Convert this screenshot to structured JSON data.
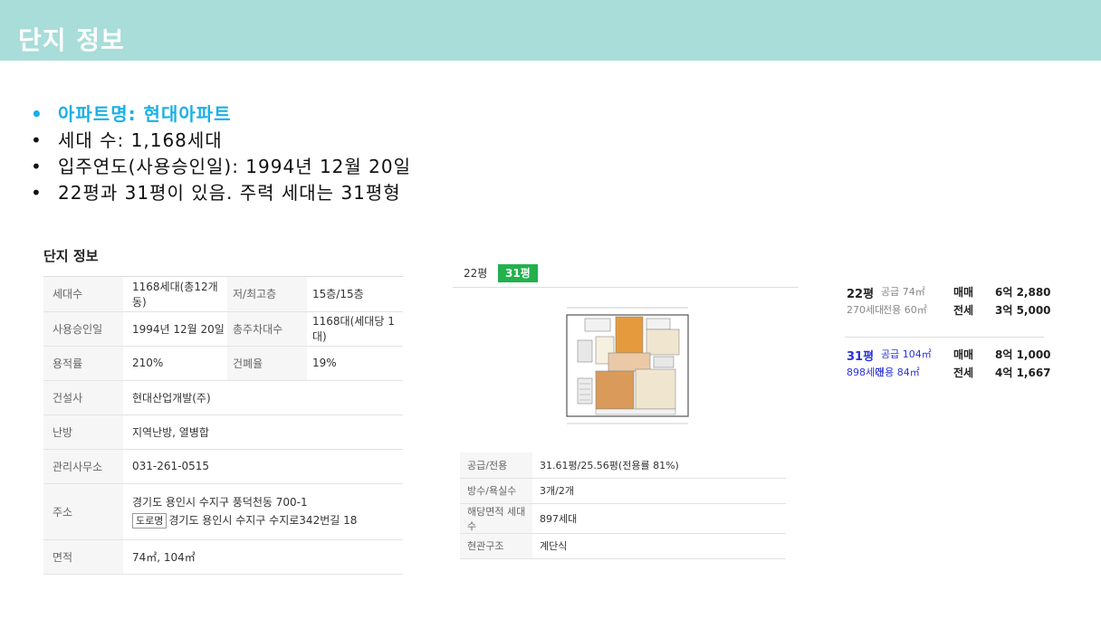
{
  "header": {
    "title": "단지 정보"
  },
  "bullets": [
    "아파트명: 현대아파트",
    "세대 수: 1,168세대",
    "입주연도(사용승인일): 1994년 12월 20일",
    "22평과 31평이 있음. 주력 세대는 31평형"
  ],
  "info": {
    "title": "단지 정보",
    "rows": {
      "units_label": "세대수",
      "units_value": "1168세대(총12개동)",
      "floors_label": "저/최고층",
      "floors_value": "15층/15층",
      "approval_label": "사용승인일",
      "approval_value": "1994년 12월 20일",
      "parking_label": "총주차대수",
      "parking_value": "1168대(세대당 1대)",
      "far_label": "용적률",
      "far_value": "210%",
      "bcr_label": "건폐율",
      "bcr_value": "19%",
      "builder_label": "건설사",
      "builder_value": "현대산업개발(주)",
      "heating_label": "난방",
      "heating_value": "지역난방, 열병합",
      "office_label": "관리사무소",
      "office_value": "031-261-0515",
      "address_label": "주소",
      "address_jibun": "경기도 용인시 수지구 풍덕천동 700-1",
      "road_tag": "도로명",
      "address_road": "경기도 용인시 수지구 수지로342번길 18",
      "area_label": "면적",
      "area_value": "74㎡, 104㎡"
    }
  },
  "floorplan": {
    "tabs": {
      "t22": "22평",
      "t31": "31평"
    },
    "selected_tab": "31평",
    "spec": {
      "supply_label": "공급/전용",
      "supply_value": "31.61평/25.56평(전용률 81%)",
      "rooms_label": "방수/욕실수",
      "rooms_value": "3개/2개",
      "count_label": "해당면적 세대수",
      "count_value": "897세대",
      "entry_label": "현관구조",
      "entry_value": "계단식"
    }
  },
  "prices": {
    "p22": {
      "size": "22평",
      "supply": "공급 74㎡",
      "units": "270세대",
      "exclusive": "전용 60㎡",
      "sale_label": "매매",
      "sale_value": "6억 2,880",
      "lease_label": "전세",
      "lease_value": "3억 5,000"
    },
    "p31": {
      "size": "31평",
      "supply": "공급 104㎡",
      "units": "898세대",
      "exclusive": "전용 84㎡",
      "sale_label": "매매",
      "sale_value": "8억 1,000",
      "lease_label": "전세",
      "lease_value": "4억 1,667"
    }
  },
  "colors": {
    "header_bg": "#a8ddd9",
    "highlight": "#1ab0e8",
    "tab_active": "#22b14c",
    "price_blue": "#2b33d6"
  }
}
